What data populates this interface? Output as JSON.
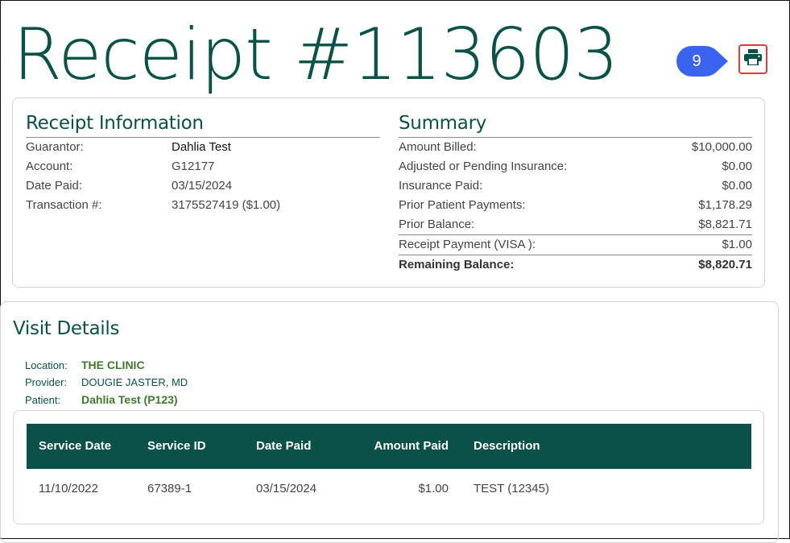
{
  "page": {
    "title": "Receipt #113603",
    "step_badge": "9",
    "print_icon": "printer-icon"
  },
  "receipt_info": {
    "heading": "Receipt Information",
    "rows": [
      {
        "label": "Guarantor:",
        "value": "Dahlia Test"
      },
      {
        "label": "Account:",
        "value": "G12177"
      },
      {
        "label": "Date Paid:",
        "value": "03/15/2024"
      },
      {
        "label": "Transaction #:",
        "value": "3175527419 ($1.00)"
      }
    ]
  },
  "summary": {
    "heading": "Summary",
    "rows": [
      {
        "label": "Amount Billed:",
        "value": "$10,000.00"
      },
      {
        "label": "Adjusted or Pending Insurance:",
        "value": "$0.00"
      },
      {
        "label": "Insurance Paid:",
        "value": "$0.00"
      },
      {
        "label": "Prior Patient Payments:",
        "value": "$1,178.29"
      },
      {
        "label": "Prior Balance:",
        "value": "$8,821.71"
      },
      {
        "label": "Receipt Payment (VISA ):",
        "value": "$1.00"
      },
      {
        "label": "Remaining Balance:",
        "value": "$8,820.71"
      }
    ]
  },
  "visit": {
    "heading": "Visit Details",
    "location_label": "Location:",
    "location_value": "THE CLINIC",
    "provider_label": "Provider:",
    "provider_value": "DOUGIE JASTER, MD",
    "patient_label": "Patient:",
    "patient_value": "Dahlia Test (P123)"
  },
  "table": {
    "headers": [
      "Service Date",
      "Service ID",
      "Date Paid",
      "Amount Paid",
      "Description"
    ],
    "rows": [
      [
        "11/10/2022",
        "67389-1",
        "03/15/2024",
        "$1.00",
        "TEST (12345)"
      ]
    ]
  },
  "colors": {
    "brand": "#0a5148",
    "accent_green": "#3f7a2f",
    "badge": "#3a63f0",
    "highlight": "#e03b3b"
  }
}
